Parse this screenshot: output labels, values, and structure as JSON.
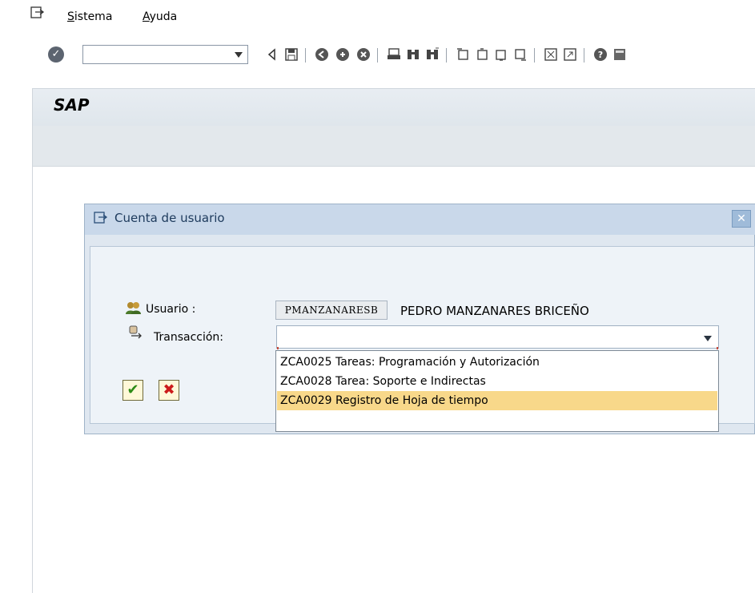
{
  "menu": {
    "items": [
      {
        "label": "Sistema",
        "accel": "S"
      },
      {
        "label": "Ayuda",
        "accel": "A"
      }
    ]
  },
  "toolbar": {
    "command_value": "",
    "icons": [
      "back-icon",
      "save-icon",
      "nav-back-icon",
      "exit-icon",
      "cancel-icon",
      "print-icon",
      "find-icon",
      "find-next-icon",
      "first-page-icon",
      "prev-page-icon",
      "next-page-icon",
      "last-page-icon",
      "new-session-icon",
      "shortcut-icon",
      "help-icon",
      "layout-icon"
    ]
  },
  "app": {
    "title": "SAP"
  },
  "dialog": {
    "title": "Cuenta de usuario",
    "user_label": "Usuario :",
    "user_id": "PMANZANARESB",
    "user_name": "PEDRO MANZANARES BRICEÑO",
    "tx_label": "Transacción:",
    "tx_value": "",
    "options": [
      {
        "label": "ZCA0025 Tareas: Programación y Autorización",
        "selected": false
      },
      {
        "label": "ZCA0028 Tarea: Soporte e Indirectas",
        "selected": false
      },
      {
        "label": "ZCA0029 Registro de Hoja de tiempo",
        "selected": true
      }
    ]
  },
  "colors": {
    "selection": "#f8d88a",
    "dialog_bg": "#dfe7f0",
    "title_bg": "#c9d8ea"
  }
}
